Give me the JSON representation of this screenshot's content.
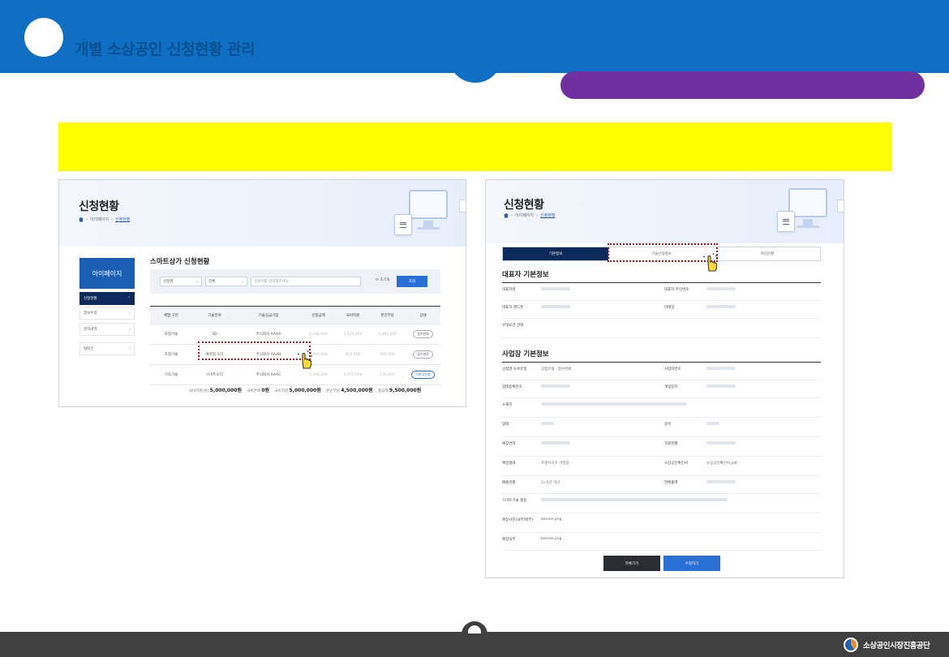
{
  "slide": {
    "title": "개별 소상공인 신청현황 관리",
    "footer_org": "소상공인시장진흥공단"
  },
  "colors": {
    "header_blue": "#0f6fc3",
    "pill_purple": "#7030a0",
    "highlight_yellow": "#ffff00",
    "footer_gray": "#404040",
    "marker_red": "#b2161c"
  },
  "left": {
    "page_title": "신청현황",
    "breadcrumb": [
      "아이페이지",
      "신청현황"
    ],
    "sidebar": {
      "header": "아이페이지",
      "items": [
        "신청현황",
        "정보수정",
        "문의내역",
        "탈퇴신"
      ]
    },
    "section_title": "스마트상가 신청현황",
    "search": {
      "select1": "신청명",
      "select2": "전체",
      "placeholder": "검색어를 입력해주세요",
      "reset_label": "초기화",
      "button_label": "조회"
    },
    "table": {
      "headers": [
        "체험 구분",
        "기술분야",
        "기술공급기업",
        "신청금액",
        "국비지원",
        "본인부담",
        "상태"
      ],
      "rows": [
        [
          "조정기술",
          "3D",
          "주식회사 AAAA",
          "6,100,000",
          "2,620,000",
          "3,480,000",
          "접수완료"
        ],
        [
          "조정기술",
          "예약형 오더",
          "주식회사 AAAB",
          "7,300,000",
          "910,000",
          "350,000",
          "접수완료"
        ],
        [
          "기초기술",
          "스마트오더",
          "주식회사 AAAC",
          "5,200,000",
          "5,070,000",
          "130,000",
          "기본고신청"
        ]
      ]
    },
    "totals": [
      {
        "label": "국비지원(원)",
        "value": "5,000,000원"
      },
      {
        "label": "국비면제",
        "value": "0원"
      },
      {
        "label": "국비지원",
        "value": "5,000,000원"
      },
      {
        "label": "본인부담",
        "value": "4,500,000원"
      },
      {
        "label": "총금액",
        "value": "9,500,000원"
      }
    ]
  },
  "right": {
    "page_title": "신청현황",
    "breadcrumb": [
      "아이페이지",
      "신청현황"
    ],
    "tabs": [
      "기본정보",
      "기술신청정보",
      "처리현황"
    ],
    "section1": "대표자 기본정보",
    "section1_rows": [
      {
        "l1": "대표자명",
        "l2": "대표자 주민번호"
      },
      {
        "l1": "대표자 핸드폰",
        "l2": "이메일"
      },
      {
        "l1": "우대요건 선택",
        "l2": ""
      }
    ],
    "section2": "사업장 기본정보",
    "section2_rows": [
      {
        "l1": "상점명 소속유형",
        "v1": "상점유형 · 접수완료",
        "l2": "사업자번호"
      },
      {
        "l1": "업태등록번호",
        "l2": "개업일자"
      },
      {
        "l1": "소재지",
        "l2": ""
      },
      {
        "l1": "업태",
        "l2": "종목"
      },
      {
        "l1": "매장면적",
        "l2": "직원현황"
      },
      {
        "l1": "매장형태",
        "v1": "프랜차이즈 가맹점",
        "l2": "소상공인확인서",
        "v2": "소상공인확인서.pdf"
      },
      {
        "l1": "매출현황",
        "v1": "2~5년 미만",
        "l2": "연매출액"
      },
      {
        "l1": "스마트기술 활용",
        "v1": "",
        "l2": ""
      },
      {
        "l1": "매장사진(내부/외부)",
        "v1": "banner.png",
        "l2": ""
      },
      {
        "l1": "매장내부",
        "v1": "banner.png",
        "l2": ""
      }
    ],
    "btn_list": "목록가기",
    "btn_edit": "수정하기"
  }
}
